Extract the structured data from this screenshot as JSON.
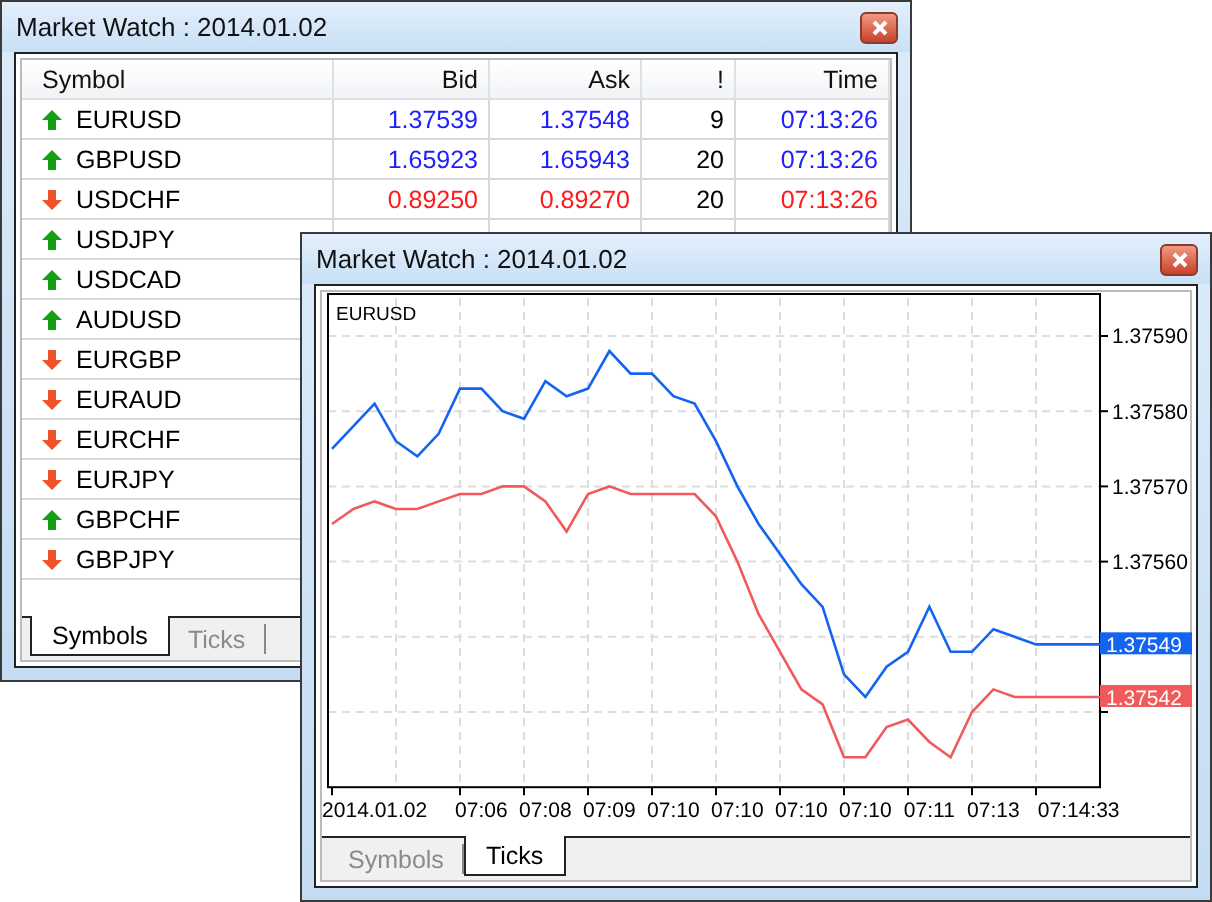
{
  "windows": [
    {
      "title": "Market Watch : 2014.01.02",
      "table": {
        "columns": [
          "Symbol",
          "Bid",
          "Ask",
          "!",
          "Time"
        ],
        "rows": [
          {
            "symbol": "EURUSD",
            "kind": "up",
            "bid": "1.37539",
            "ask": "1.37548",
            "spread": "9",
            "time": "07:13:26"
          },
          {
            "symbol": "GBPUSD",
            "kind": "up",
            "bid": "1.65923",
            "ask": "1.65943",
            "spread": "20",
            "time": "07:13:26"
          },
          {
            "symbol": "USDCHF",
            "kind": "down",
            "bid": "0.89250",
            "ask": "0.89270",
            "spread": "20",
            "time": "07:13:26"
          },
          {
            "symbol": "USDJPY",
            "kind": "up"
          },
          {
            "symbol": "USDCAD",
            "kind": "up"
          },
          {
            "symbol": "AUDUSD",
            "kind": "up"
          },
          {
            "symbol": "EURGBP",
            "kind": "down"
          },
          {
            "symbol": "EURAUD",
            "kind": "down"
          },
          {
            "symbol": "EURCHF",
            "kind": "down"
          },
          {
            "symbol": "EURJPY",
            "kind": "down"
          },
          {
            "symbol": "GBPCHF",
            "kind": "up"
          },
          {
            "symbol": "GBPJPY",
            "kind": "down"
          }
        ]
      },
      "tabs": [
        {
          "label": "Symbols",
          "selected": true
        },
        {
          "label": "Ticks",
          "selected": false
        }
      ]
    },
    {
      "title": "Market Watch : 2014.01.02",
      "chart": {
        "chart_data": {
          "type": "line",
          "title": "EURUSD",
          "categories": [
            null,
            null,
            "2014.01.02",
            null,
            null,
            null,
            null,
            "07:06",
            null,
            null,
            "07:08",
            null,
            null,
            "07:09",
            null,
            null,
            "07:10",
            null,
            null,
            "07:10",
            null,
            null,
            "07:10",
            null,
            null,
            "07:10",
            null,
            null,
            "07:11",
            null,
            null,
            "07:13",
            null,
            null,
            null,
            "07:14:33",
            null
          ],
          "series": [
            {
              "color": "#1464f0",
              "values": [
                1.37575,
                1.37578,
                1.37581,
                1.37576,
                1.37574,
                1.37577,
                1.37583,
                1.37583,
                1.3758,
                1.37579,
                1.37584,
                1.37582,
                1.37583,
                1.37588,
                1.37585,
                1.37585,
                1.37582,
                1.37581,
                1.37576,
                1.3757,
                1.37565,
                1.37561,
                1.37557,
                1.37554,
                1.37545,
                1.37542,
                1.37546,
                1.37548,
                1.37554,
                1.37548,
                1.37548,
                1.37551,
                1.3755,
                1.37549,
                1.37549,
                1.37549,
                1.37549
              ]
            },
            {
              "color": "#f05a5a",
              "values": [
                1.37565,
                1.37567,
                1.37568,
                1.37567,
                1.37567,
                1.37568,
                1.37569,
                1.37569,
                1.3757,
                1.3757,
                1.37568,
                1.37564,
                1.37569,
                1.3757,
                1.37569,
                1.37569,
                1.37569,
                1.37569,
                1.37566,
                1.3756,
                1.37553,
                1.37548,
                1.37543,
                1.37541,
                1.37534,
                1.37534,
                1.37538,
                1.37539,
                1.37536,
                1.37534,
                1.3754,
                1.37543,
                1.37542,
                1.37542,
                1.37542,
                1.37542,
                1.37542
              ]
            }
          ],
          "ylim": [
            1.3753,
            1.37595
          ],
          "yticks": [
            {
              "value": 1.3759,
              "label": "1.37590"
            },
            {
              "value": 1.3758,
              "label": "1.37580"
            },
            {
              "value": 1.3757,
              "label": "1.37570"
            },
            {
              "value": 1.3756,
              "label": "1.37560"
            }
          ],
          "grid": true,
          "annotations": [
            "1.37549",
            "1.37542"
          ]
        }
      },
      "tabs": [
        {
          "label": "Symbols",
          "selected": false
        },
        {
          "label": "Ticks",
          "selected": true
        }
      ]
    }
  ]
}
